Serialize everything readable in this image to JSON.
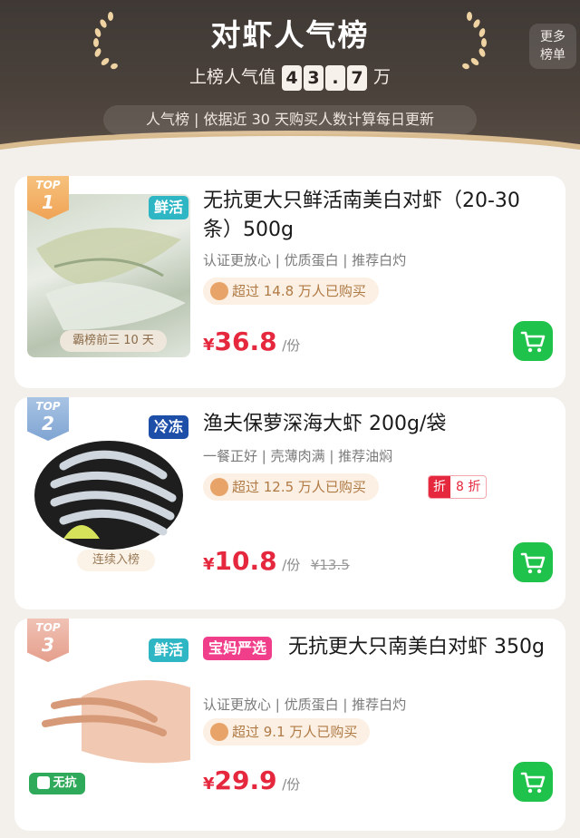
{
  "header": {
    "title": "对虾人气榜",
    "more_label_1": "更多",
    "more_label_2": "榜单",
    "popularity_label": "上榜人气值",
    "popularity_digits": [
      "4",
      "3",
      ".",
      "7"
    ],
    "popularity_unit": "万",
    "note": "人气榜 | 依据近 30 天购买人数计算每日更新"
  },
  "products": [
    {
      "rank_label": "TOP",
      "rank": "1",
      "type_tag": "鲜活",
      "image_label": "霸榜前三 10 天",
      "name": "无抗更大只鲜活南美白对虾（20-30条）500g",
      "features": "认证更放心 | 优质蛋白 | 推荐白灼",
      "buyers": "超过 14.8 万人已购买",
      "currency": "¥",
      "price": "36.8",
      "unit": "/份"
    },
    {
      "rank_label": "TOP",
      "rank": "2",
      "type_tag": "冷冻",
      "image_label": "连续入榜",
      "name": "渔夫保萝深海大虾 200g/袋",
      "features": "一餐正好 | 壳薄肉满 | 推荐油焖",
      "buyers": "超过 12.5 万人已购买",
      "discount_left": "折",
      "discount_right": "8 折",
      "currency": "¥",
      "price": "10.8",
      "unit": "/份",
      "old_price": "¥13.5"
    },
    {
      "rank_label": "TOP",
      "rank": "3",
      "type_tag": "鲜活",
      "brand_tag": "宝妈严选",
      "image_label": "无抗",
      "name": "无抗更大只南美白对虾 350g",
      "features": "认证更放心 | 优质蛋白 | 推荐白灼",
      "buyers": "超过 9.1 万人已购买",
      "currency": "¥",
      "price": "29.9",
      "unit": "/份"
    }
  ],
  "colors": {
    "header_bg": "#463e38",
    "gold": "#e9c99a",
    "price_red": "#e5283d",
    "cart_green": "#1fc24a",
    "fresh_tag": "#2fb6c4",
    "frozen_tag": "#1d4ea8",
    "brand_tag": "#f03e8a"
  },
  "icons": {
    "cart": "cart-icon",
    "laurel": "laurel-icon",
    "flame": "flame-icon",
    "shield": "shield-check-icon"
  }
}
